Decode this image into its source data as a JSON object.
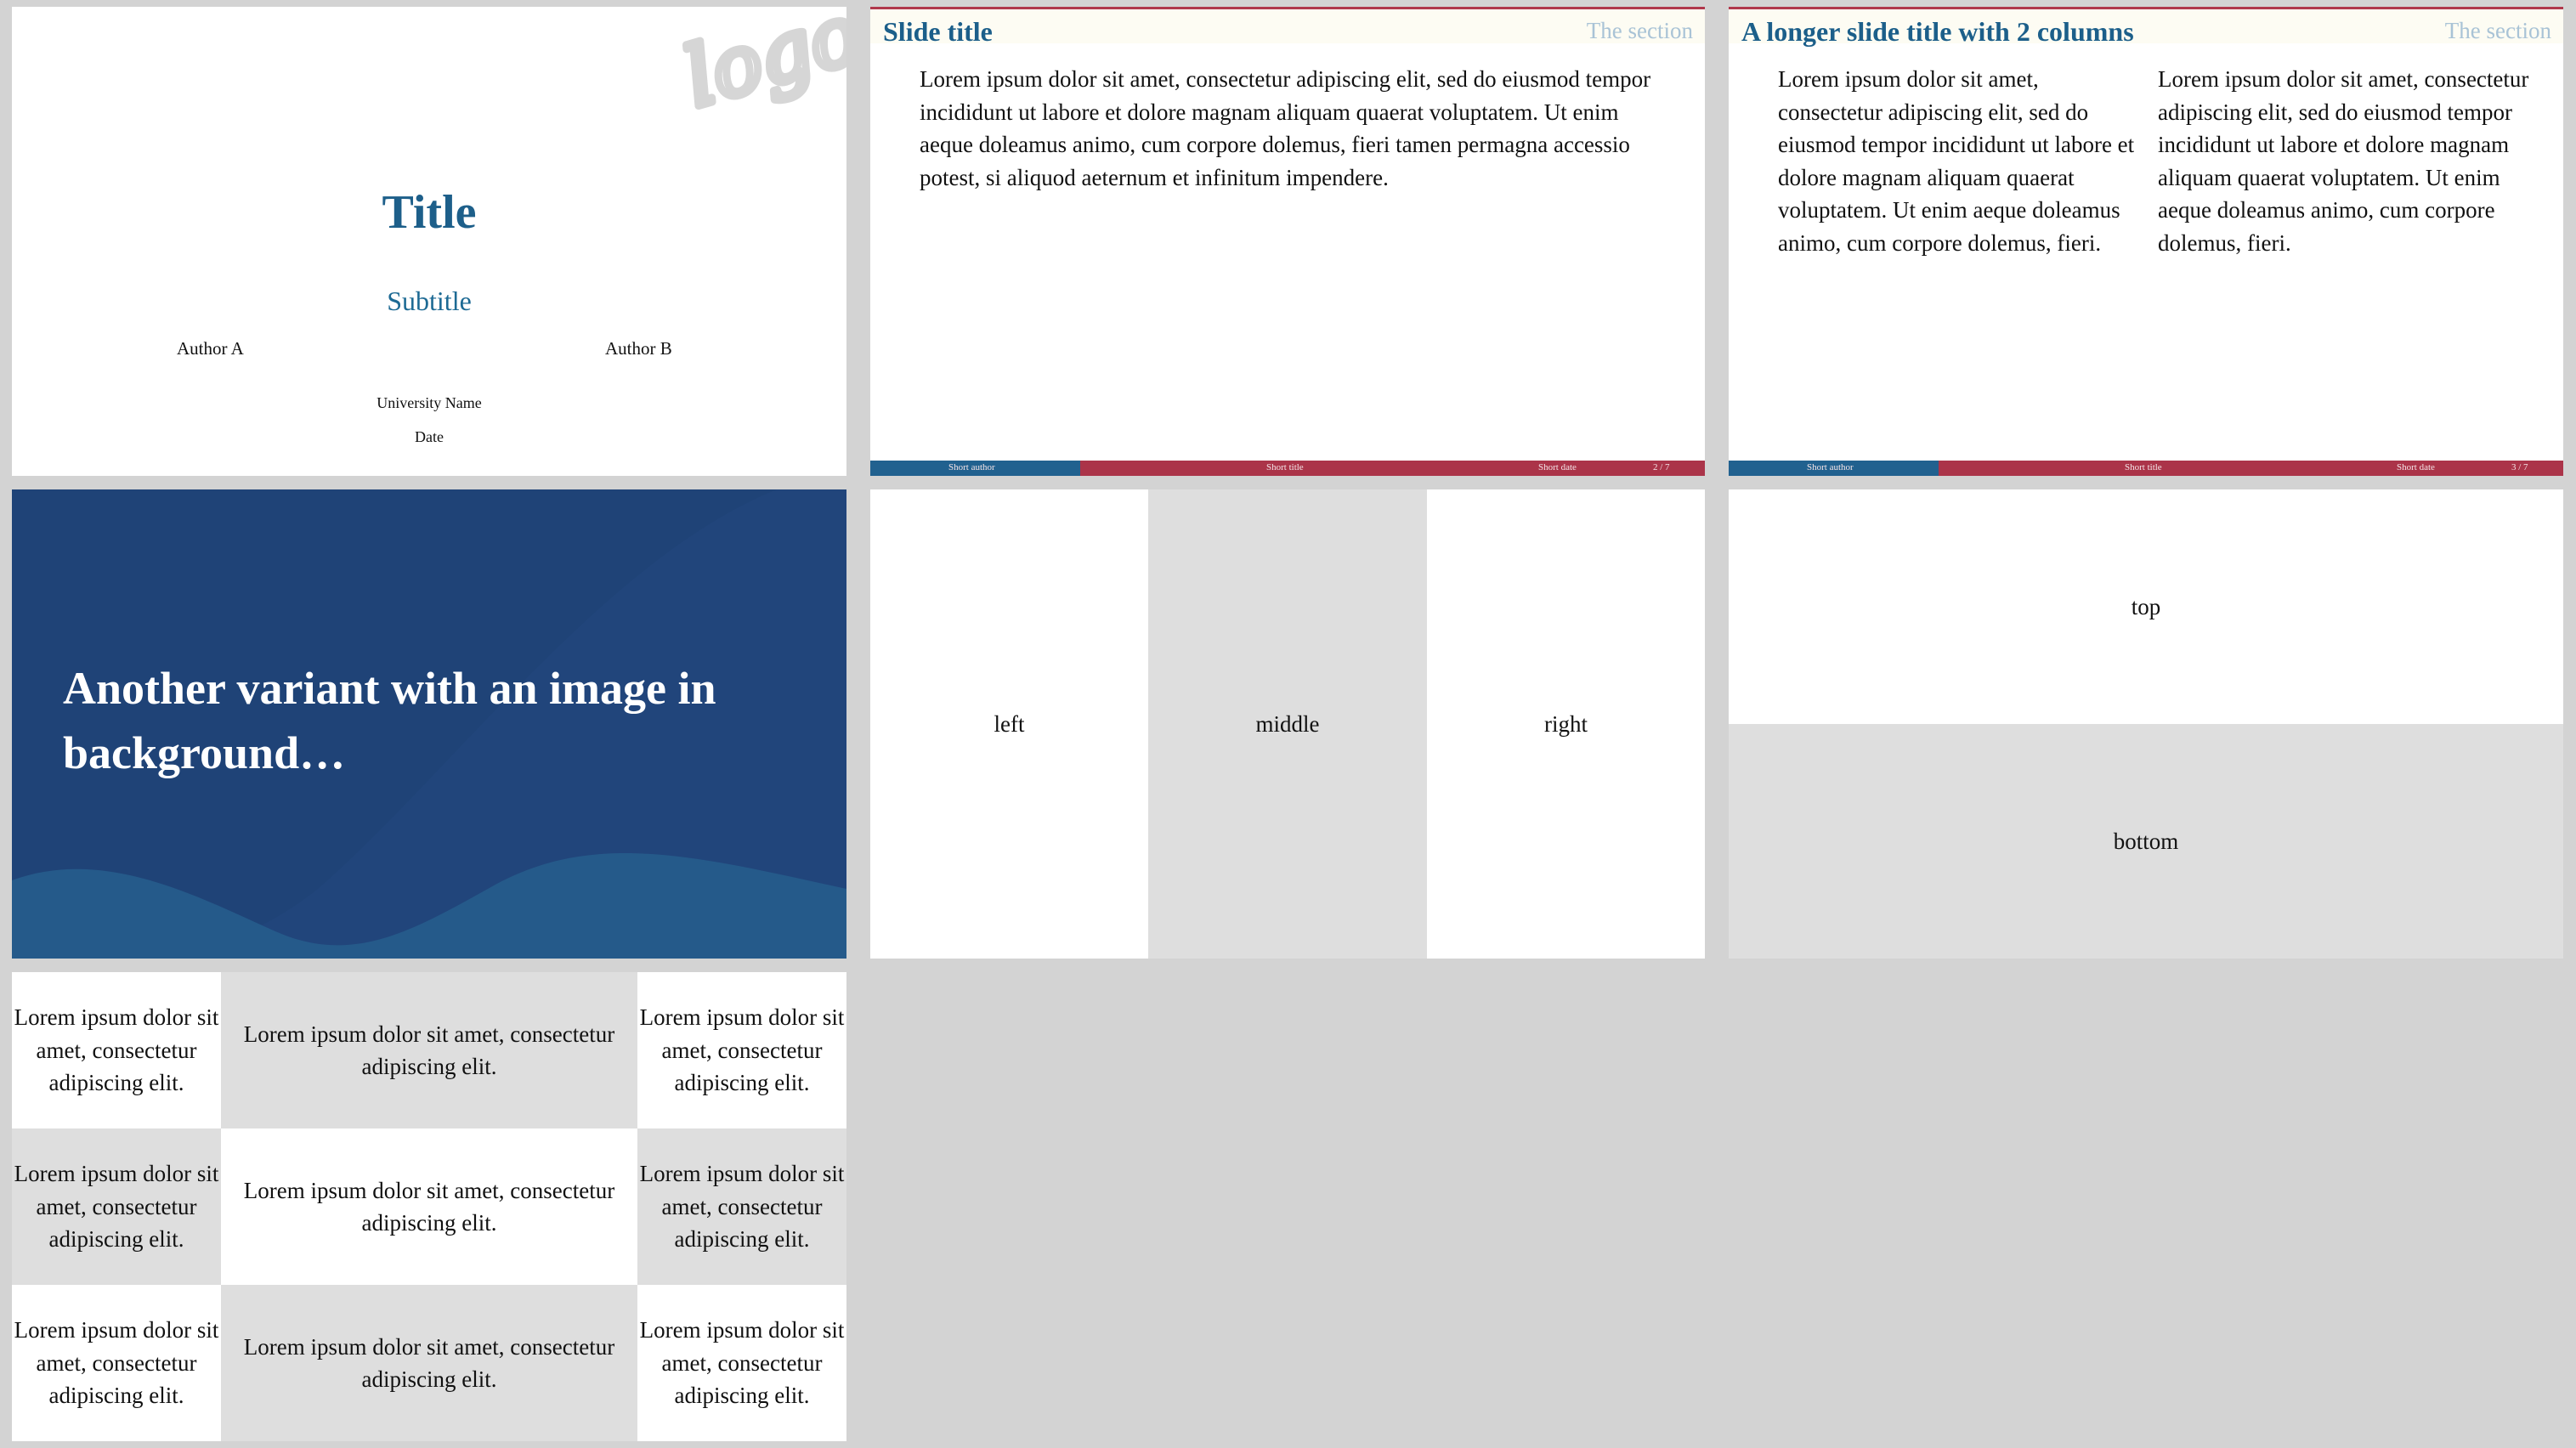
{
  "title_slide": {
    "title": "Title",
    "subtitle": "Subtitle",
    "author_a": "Author A",
    "author_b": "Author B",
    "institution": "University Name",
    "date": "Date",
    "logo_text": "logo"
  },
  "slide_basic": {
    "title": "Slide title",
    "section": "The section",
    "body": "Lorem ipsum dolor sit amet, consectetur adipiscing elit, sed do eiusmod tempor incididunt ut labore et dolore magnam aliquam quaerat voluptatem. Ut enim aeque doleamus animo, cum corpore dolemus, fieri tamen permagna accessio potest, si aliquod aeternum et infinitum impendere.",
    "footer": {
      "author": "Short author",
      "title": "Short title",
      "date": "Short date",
      "page": "2 / 7"
    }
  },
  "slide_two_columns": {
    "title": "A longer slide title with 2 columns",
    "section": "The section",
    "col1": "Lorem ipsum dolor sit amet, consectetur adipiscing elit, sed do eiusmod tempor incididunt ut labore et dolore magnam aliquam quaerat voluptatem. Ut enim aeque doleamus animo, cum corpore dolemus, fieri.",
    "col2": "Lorem ipsum dolor sit amet, consectetur adipiscing elit, sed do eiusmod tempor incididunt ut labore et dolore magnam aliquam quaerat voluptatem. Ut enim aeque doleamus animo, cum corpore dolemus, fieri.",
    "footer": {
      "author": "Short author",
      "title": "Short title",
      "date": "Short date",
      "page": "3 / 7"
    }
  },
  "slide_background": {
    "title": "Another variant with an image in background…",
    "colors": {
      "bg": "#1f4377",
      "wave": "#255a8a",
      "arc": "#21467b"
    }
  },
  "slide_columns": {
    "left": "left",
    "middle": "middle",
    "right": "right"
  },
  "slide_rows": {
    "top": "top",
    "bottom": "bottom"
  },
  "slide_grid": {
    "cells": [
      [
        "Lorem ipsum dolor sit amet, consectetur adipiscing elit.",
        "Lorem ipsum dolor sit amet, consectetur adipiscing elit.",
        "Lorem ipsum dolor sit amet, consectetur adipiscing elit."
      ],
      [
        "Lorem ipsum dolor sit amet, consectetur adipiscing elit.",
        "Lorem ipsum dolor sit amet, consectetur adipiscing elit.",
        "Lorem ipsum dolor sit amet, consectetur adipiscing elit."
      ],
      [
        "Lorem ipsum dolor sit amet, consectetur adipiscing elit.",
        "Lorem ipsum dolor sit amet, consectetur adipiscing elit.",
        "Lorem ipsum dolor sit amet, consectetur adipiscing elit."
      ]
    ]
  },
  "colors": {
    "title_blue": "#1d5f8a",
    "accent_red": "#ab3449",
    "footer_blue": "#21618f",
    "section_grey_blue": "#a9c3d6",
    "page_background": "#d3d3d3",
    "pane_grey": "#dedede"
  }
}
